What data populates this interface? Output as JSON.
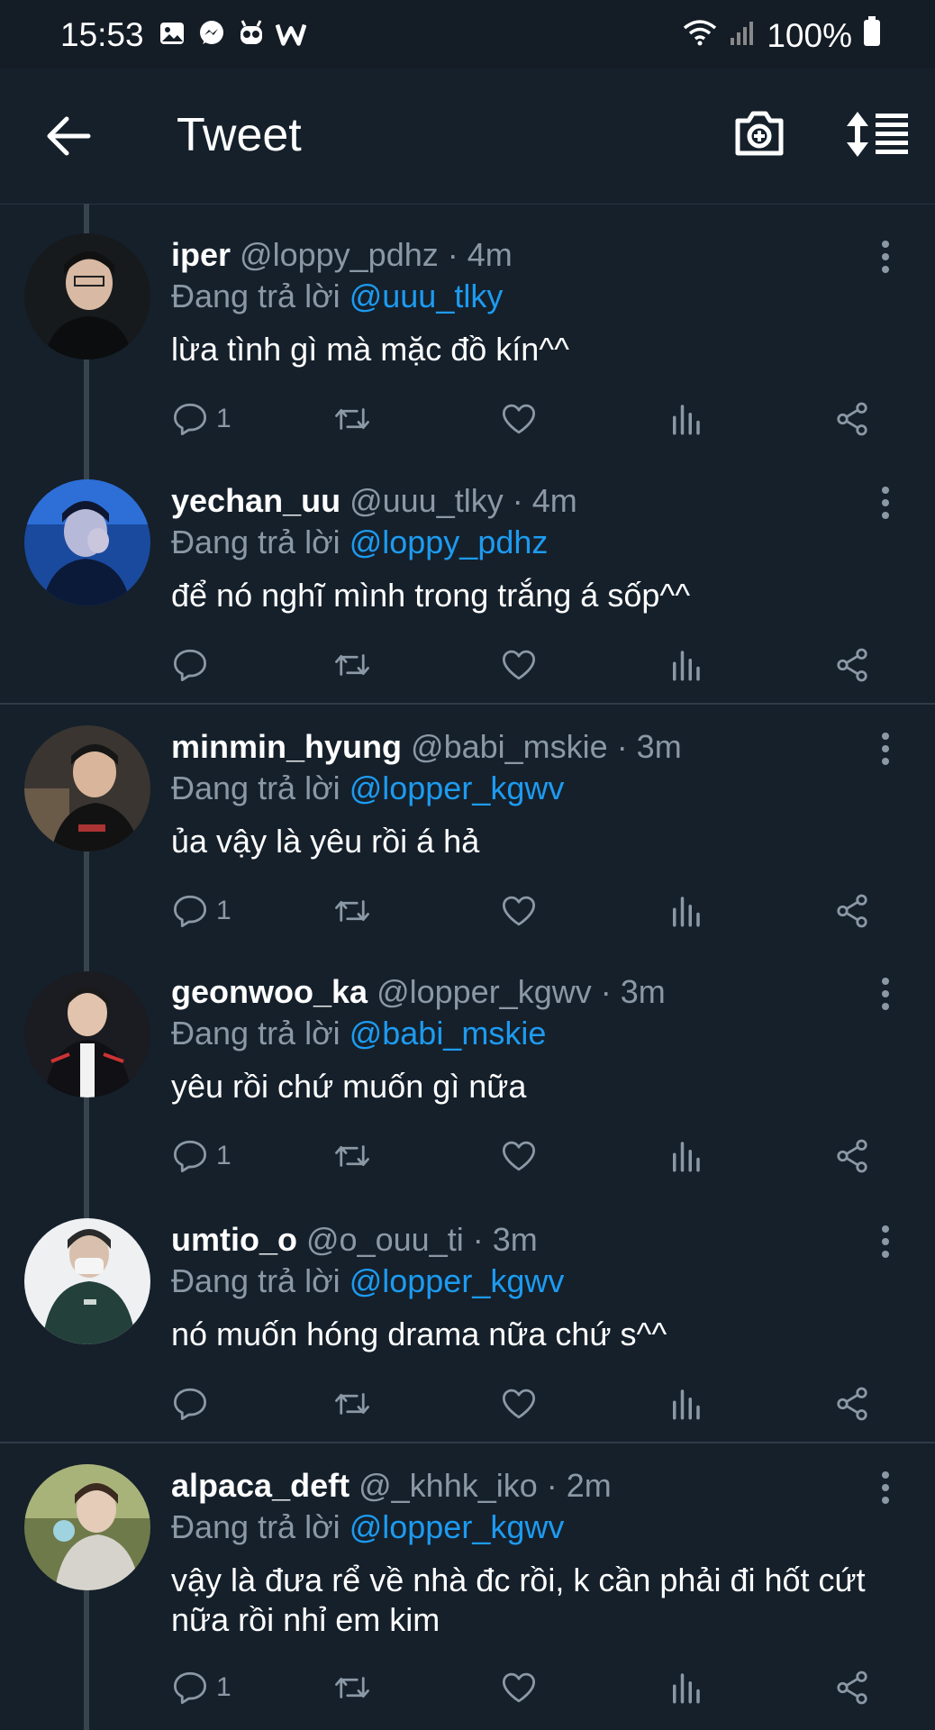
{
  "status_bar": {
    "time": "15:53",
    "battery": "100%",
    "icons": [
      "gallery-icon",
      "messenger-icon",
      "mascot-icon",
      "w-app-icon",
      "wifi-icon",
      "signal-icon",
      "battery-icon"
    ]
  },
  "header": {
    "title": "Tweet",
    "icons": [
      "back-arrow-icon",
      "camera-plus-icon",
      "sort-icon"
    ]
  },
  "colors": {
    "background": "#15202b",
    "mention": "#1d9bf0",
    "secondary": "#8b98a5",
    "divider": "#2f3b47"
  },
  "tweets": [
    {
      "name": "iper",
      "handle": "@loppy_pdhz",
      "time": "· 4m",
      "reply_prefix": "Đang trả lời",
      "reply_to": "@uuu_tlky",
      "text": "lừa tình gì mà mặc đồ kín^^",
      "reply_count": "1"
    },
    {
      "name": "yechan_uu",
      "handle": "@uuu_tlky",
      "time": "· 4m",
      "reply_prefix": "Đang trả lời",
      "reply_to": "@loppy_pdhz",
      "text": "để nó nghĩ mình trong trắng á sốp^^",
      "reply_count": ""
    },
    {
      "name": "minmin_hyung",
      "handle": "@babi_mskie",
      "time": "· 3m",
      "reply_prefix": "Đang trả lời",
      "reply_to": "@lopper_kgwv",
      "text": "ủa vậy là yêu rồi á hả",
      "reply_count": "1"
    },
    {
      "name": "geonwoo_ka",
      "handle": "@lopper_kgwv",
      "time": "· 3m",
      "reply_prefix": "Đang trả lời",
      "reply_to": "@babi_mskie",
      "text": "yêu rồi chứ muốn gì nữa",
      "reply_count": "1"
    },
    {
      "name": "umtio_o",
      "handle": "@o_ouu_ti",
      "time": "· 3m",
      "reply_prefix": "Đang trả lời",
      "reply_to": "@lopper_kgwv",
      "text": "nó muốn hóng drama nữa chứ s^^",
      "reply_count": ""
    },
    {
      "name": "alpaca_deft",
      "handle": "@_khhk_iko",
      "time": "· 2m",
      "reply_prefix": "Đang trả lời",
      "reply_to": "@lopper_kgwv",
      "text": "vậy là đưa rể về nhà đc rồi, k cần phải đi hốt cứt nữa rồi nhỉ em kim",
      "reply_count": "1"
    }
  ]
}
